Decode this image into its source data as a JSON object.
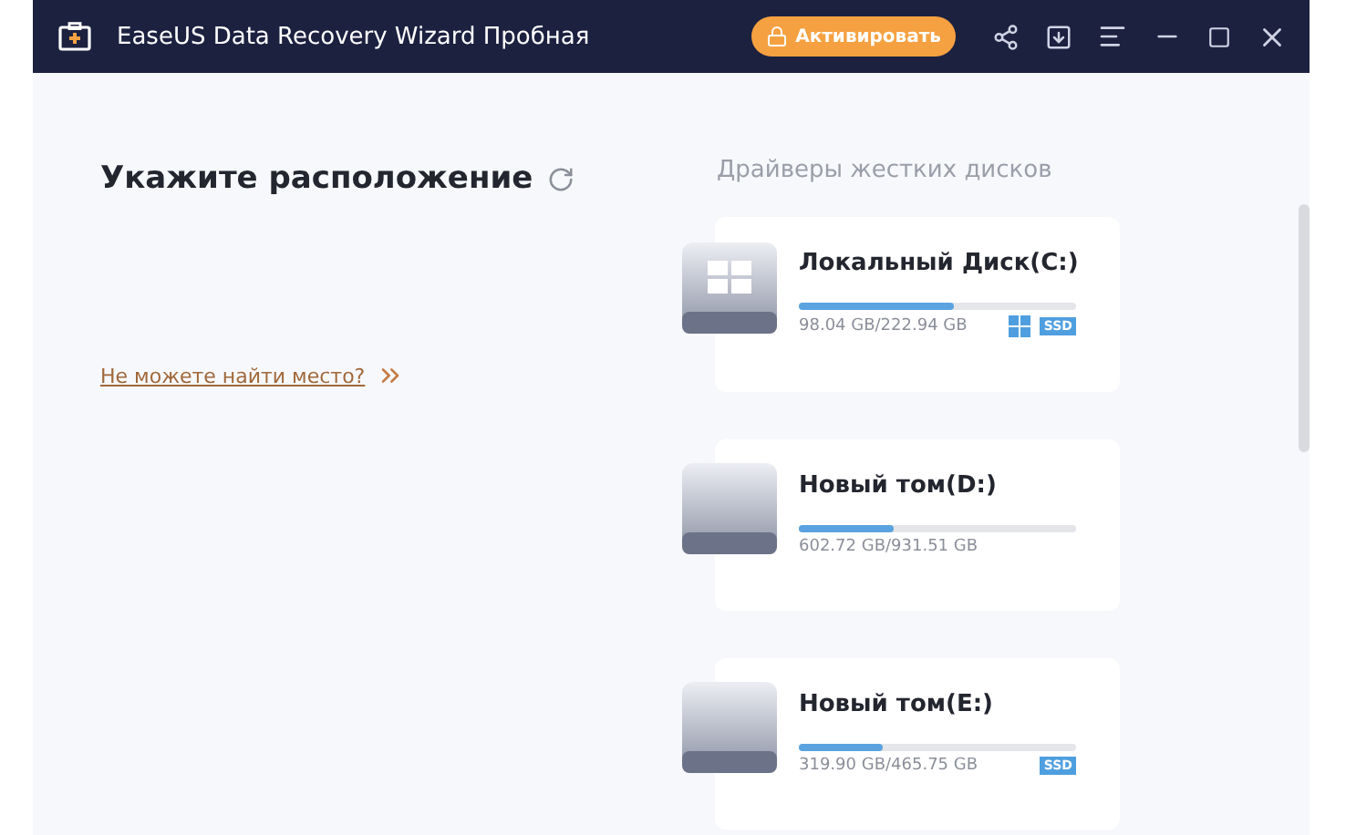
{
  "window": {
    "title": "EaseUS Data Recovery Wizard Пробная",
    "activate_button": "Активировать"
  },
  "location": {
    "heading": "Укажите расположение",
    "help_link": "Не можете найти место?"
  },
  "drives_section": {
    "title": "Драйверы жестких дисков",
    "drives": [
      {
        "name": "Локальный Диск(C:)",
        "usage": "98.04 GB/222.94 GB",
        "level": 0.56,
        "system": true,
        "badge": "SSD"
      },
      {
        "name": "Новый том(D:)",
        "usage": "602.72 GB/931.51 GB",
        "level": 0.34,
        "system": false
      },
      {
        "name": "Новый том(E:)",
        "usage": "319.90 GB/465.75 GB",
        "level": 0.3,
        "system": false,
        "badge": "SSD"
      }
    ]
  }
}
